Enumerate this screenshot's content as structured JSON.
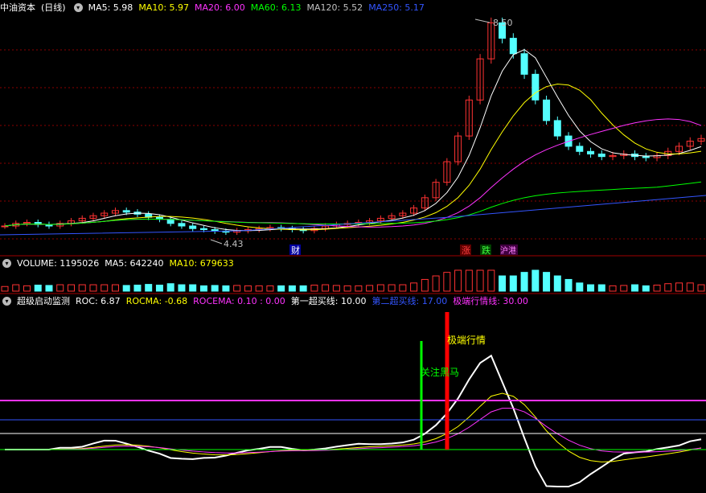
{
  "price_header": {
    "stock": "中油资本",
    "period": "(日线)",
    "ma5": "MA5: 5.98",
    "ma10": "MA10: 5.97",
    "ma20": "MA20: 6.00",
    "ma60": "MA60: 6.13",
    "ma120": "MA120: 5.52",
    "ma250": "MA250: 5.17"
  },
  "price_labels": {
    "high": "8.50",
    "low": "4.43",
    "cai": "财",
    "zhang": "涨",
    "die": "跌",
    "gang": "沪港"
  },
  "vol_header": {
    "volume": "VOLUME: 1195026",
    "ma5": "MA5: 642240",
    "ma10": "MA10: 679633"
  },
  "ind_header": {
    "name": "超级启动监测",
    "roc": "ROC: 6.87",
    "rocma": "ROCMA: -0.68",
    "rocema": "ROCEMA: 0.10 : 0.00",
    "buy1": "第一超买线: 10.00",
    "buy2": "第二超买线: 17.00",
    "extreme": "极端行情线: 30.00"
  },
  "annotations": {
    "extreme_label": "极端行情",
    "dark_horse": "关注黑马"
  },
  "colors": {
    "up": "#ff3232",
    "down": "#54ffff",
    "ma5": "#ffffff",
    "ma10": "#ffff00",
    "ma20": "#ff33ff",
    "ma60": "#00ff00",
    "ma120": "#8080ff",
    "ma250": "#3355ff"
  },
  "chart_data": {
    "type": "line",
    "candles_close": [
      4.55,
      4.6,
      4.62,
      4.58,
      4.55,
      4.6,
      4.65,
      4.7,
      4.75,
      4.8,
      4.85,
      4.82,
      4.78,
      4.72,
      4.68,
      4.6,
      4.55,
      4.5,
      4.48,
      4.45,
      4.43,
      4.46,
      4.48,
      4.5,
      4.52,
      4.5,
      4.48,
      4.46,
      4.5,
      4.55,
      4.58,
      4.6,
      4.62,
      4.65,
      4.7,
      4.75,
      4.8,
      4.9,
      5.1,
      5.4,
      5.8,
      6.3,
      7.0,
      7.8,
      8.5,
      8.2,
      7.9,
      7.5,
      7.0,
      6.6,
      6.3,
      6.1,
      6.0,
      5.95,
      5.9,
      5.92,
      5.95,
      5.9,
      5.88,
      5.92,
      6.0,
      6.1,
      6.2,
      6.25
    ],
    "roc_indicator_lines": {
      "extreme": 30,
      "buy2": 17,
      "buy1": 10,
      "zero": 0
    }
  }
}
